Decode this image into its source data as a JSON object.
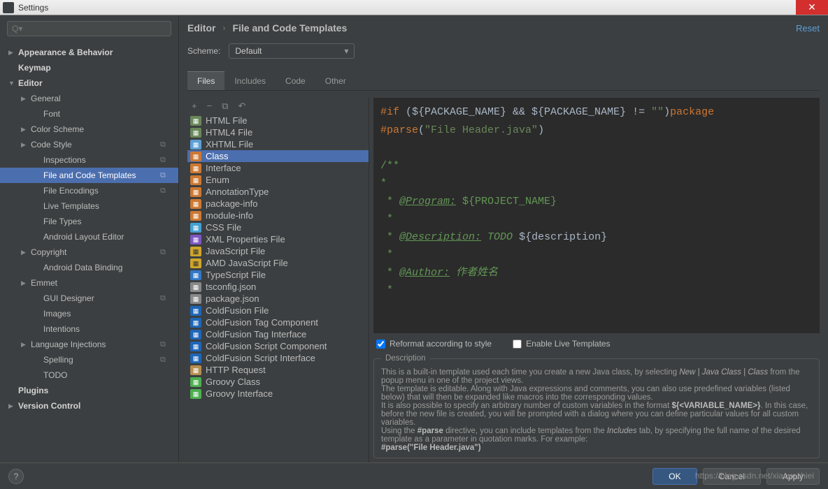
{
  "window": {
    "title": "Settings"
  },
  "search": {
    "placeholder": "Q▾"
  },
  "reset_label": "Reset",
  "breadcrumb": [
    "Editor",
    "File and Code Templates"
  ],
  "scheme": {
    "label": "Scheme:",
    "value": "Default"
  },
  "tabs": [
    "Files",
    "Includes",
    "Code",
    "Other"
  ],
  "active_tab": 0,
  "tree": [
    {
      "label": "Appearance & Behavior",
      "indent": 0,
      "arrow": "▶",
      "bold": true
    },
    {
      "label": "Keymap",
      "indent": 0,
      "arrow": "",
      "bold": true
    },
    {
      "label": "Editor",
      "indent": 0,
      "arrow": "▼",
      "bold": true
    },
    {
      "label": "General",
      "indent": 1,
      "arrow": "▶"
    },
    {
      "label": "Font",
      "indent": 2,
      "arrow": ""
    },
    {
      "label": "Color Scheme",
      "indent": 1,
      "arrow": "▶"
    },
    {
      "label": "Code Style",
      "indent": 1,
      "arrow": "▶",
      "micon": true
    },
    {
      "label": "Inspections",
      "indent": 2,
      "arrow": "",
      "micon": true
    },
    {
      "label": "File and Code Templates",
      "indent": 2,
      "arrow": "",
      "selected": true,
      "micon": true
    },
    {
      "label": "File Encodings",
      "indent": 2,
      "arrow": "",
      "micon": true
    },
    {
      "label": "Live Templates",
      "indent": 2,
      "arrow": ""
    },
    {
      "label": "File Types",
      "indent": 2,
      "arrow": ""
    },
    {
      "label": "Android Layout Editor",
      "indent": 2,
      "arrow": ""
    },
    {
      "label": "Copyright",
      "indent": 1,
      "arrow": "▶",
      "micon": true
    },
    {
      "label": "Android Data Binding",
      "indent": 2,
      "arrow": ""
    },
    {
      "label": "Emmet",
      "indent": 1,
      "arrow": "▶"
    },
    {
      "label": "GUI Designer",
      "indent": 2,
      "arrow": "",
      "micon": true
    },
    {
      "label": "Images",
      "indent": 2,
      "arrow": ""
    },
    {
      "label": "Intentions",
      "indent": 2,
      "arrow": ""
    },
    {
      "label": "Language Injections",
      "indent": 1,
      "arrow": "▶",
      "micon": true
    },
    {
      "label": "Spelling",
      "indent": 2,
      "arrow": "",
      "micon": true
    },
    {
      "label": "TODO",
      "indent": 2,
      "arrow": ""
    },
    {
      "label": "Plugins",
      "indent": 0,
      "arrow": "",
      "bold": true
    },
    {
      "label": "Version Control",
      "indent": 0,
      "arrow": "▶",
      "bold": true
    }
  ],
  "templates": [
    {
      "label": "HTML File",
      "icon": "ic-html"
    },
    {
      "label": "HTML4 File",
      "icon": "ic-html"
    },
    {
      "label": "XHTML File",
      "icon": "ic-xhtml"
    },
    {
      "label": "Class",
      "icon": "ic-class",
      "selected": true
    },
    {
      "label": "Interface",
      "icon": "ic-class"
    },
    {
      "label": "Enum",
      "icon": "ic-class"
    },
    {
      "label": "AnnotationType",
      "icon": "ic-class"
    },
    {
      "label": "package-info",
      "icon": "ic-class"
    },
    {
      "label": "module-info",
      "icon": "ic-class"
    },
    {
      "label": "CSS File",
      "icon": "ic-css"
    },
    {
      "label": "XML Properties File",
      "icon": "ic-xml"
    },
    {
      "label": "JavaScript File",
      "icon": "ic-js"
    },
    {
      "label": "AMD JavaScript File",
      "icon": "ic-js"
    },
    {
      "label": "TypeScript File",
      "icon": "ic-ts"
    },
    {
      "label": "tsconfig.json",
      "icon": "ic-json"
    },
    {
      "label": "package.json",
      "icon": "ic-json"
    },
    {
      "label": "ColdFusion File",
      "icon": "ic-cf"
    },
    {
      "label": "ColdFusion Tag Component",
      "icon": "ic-cf"
    },
    {
      "label": "ColdFusion Tag Interface",
      "icon": "ic-cf"
    },
    {
      "label": "ColdFusion Script Component",
      "icon": "ic-cf"
    },
    {
      "label": "ColdFusion Script Interface",
      "icon": "ic-cf"
    },
    {
      "label": "HTTP Request",
      "icon": "ic-http"
    },
    {
      "label": "Groovy Class",
      "icon": "ic-groovy"
    },
    {
      "label": "Groovy Interface",
      "icon": "ic-groovy"
    }
  ],
  "toolbar": {
    "add": "+",
    "remove": "−",
    "copy": "⧉",
    "undo": "↶"
  },
  "code": {
    "l1a": "#if",
    "l1b": " (${PACKAGE_NAME} && ${PACKAGE_NAME} != ",
    "l1c": "\"\"",
    "l1d": ")",
    "l1e": "package",
    "l2a": "#parse",
    "l2b": "(",
    "l2c": "\"File Header.java\"",
    "l2d": ")",
    "l3": "/**",
    "l4": "*",
    "l5a": " * ",
    "l5b": "@Program:",
    "l5c": " ${PROJECT_NAME}",
    "l6": " *",
    "l7a": " * ",
    "l7b": "@Description:",
    "l7c": " TODO ",
    "l7d": "${description}",
    "l8": " *",
    "l9a": " * ",
    "l9b": "@Author:",
    "l9c": " 作者姓名",
    "l10": " *"
  },
  "checks": {
    "reformat": "Reformat according to style",
    "reformat_checked": true,
    "live": "Enable Live Templates",
    "live_checked": false
  },
  "description": {
    "title": "Description",
    "p1a": "This is a built-in template used each time you create a new Java class, by selecting ",
    "p1b": "New | Java Class | Class",
    "p1c": " from the popup menu in one of the project views.",
    "p2": "The template is editable. Along with Java expressions and comments, you can also use predefined variables (listed below) that will then be expanded like macros into the corresponding values.",
    "p3a": "It is also possible to specify an arbitrary number of custom variables in the format ",
    "p3b": "${<VARIABLE_NAME>}",
    "p3c": ". In this case, before the new file is created, you will be prompted with a dialog where you can define particular values for all custom variables.",
    "p4a": "Using the ",
    "p4b": "#parse",
    "p4c": " directive, you can include templates from the ",
    "p4d": "Includes",
    "p4e": " tab, by specifying the full name of the desired template as a parameter in quotation marks. For example:",
    "p5": "#parse(\"File Header.java\")"
  },
  "buttons": {
    "ok": "OK",
    "cancel": "Cancel",
    "apply": "Apply"
  },
  "watermark": "https://blog.csdn.net/xiaoyezhiei"
}
